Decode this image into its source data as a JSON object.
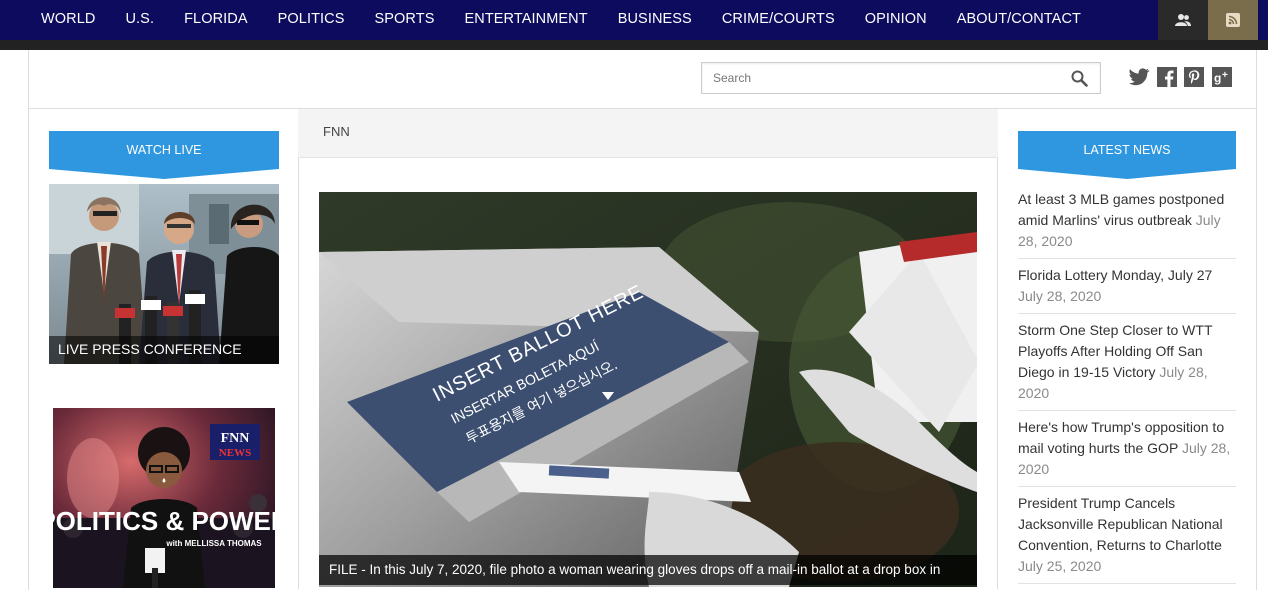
{
  "nav": {
    "items": [
      {
        "label": "WORLD"
      },
      {
        "label": "U.S."
      },
      {
        "label": "FLORIDA"
      },
      {
        "label": "POLITICS"
      },
      {
        "label": "SPORTS"
      },
      {
        "label": "ENTERTAINMENT"
      },
      {
        "label": "BUSINESS"
      },
      {
        "label": "CRIME/COURTS"
      },
      {
        "label": "OPINION"
      },
      {
        "label": "ABOUT/CONTACT"
      }
    ],
    "icons": [
      "user-icon",
      "rss-icon"
    ]
  },
  "search": {
    "placeholder": "Search"
  },
  "social": [
    "twitter-icon",
    "facebook-icon",
    "pinterest-icon",
    "google-plus-icon"
  ],
  "breadcrumb": "FNN",
  "watch_live": {
    "heading": "WATCH LIVE",
    "caption": "LIVE PRESS CONFERENCE"
  },
  "politics_power": {
    "badge_top": "FNN",
    "badge_bottom": "NEWS",
    "title": "POLITICS & POWER",
    "subtitle": "with MELLISSA THOMAS"
  },
  "main_photo": {
    "sign_line1": "INSERT BALLOT HERE",
    "sign_line2": "INSERTAR BOLETA AQUÍ",
    "sign_line3": "투표용지를 여기 넣으십시오.",
    "caption": "FILE - In this July 7, 2020, file photo a woman wearing gloves drops off a mail-in ballot at a drop box in"
  },
  "latest_news": {
    "heading": "LATEST NEWS",
    "items": [
      {
        "title": "At least 3 MLB games postponed amid Marlins' virus outbreak",
        "date": "July 28, 2020"
      },
      {
        "title": "Florida Lottery Monday, July 27",
        "date": "July 28, 2020"
      },
      {
        "title": "Storm One Step Closer to WTT Playoffs After Holding Off San Diego in 19-15 Victory",
        "date": "July 28, 2020"
      },
      {
        "title": "Here's how Trump's opposition to mail voting hurts the GOP",
        "date": "July 28, 2020"
      },
      {
        "title": "President Trump Cancels Jacksonville Republican National Convention, Returns to Charlotte",
        "date": "July 25, 2020"
      }
    ]
  },
  "colors": {
    "nav_bg": "#0d0b5e",
    "ribbon": "#2f97e0",
    "rss_bg": "#7a6d4c"
  }
}
